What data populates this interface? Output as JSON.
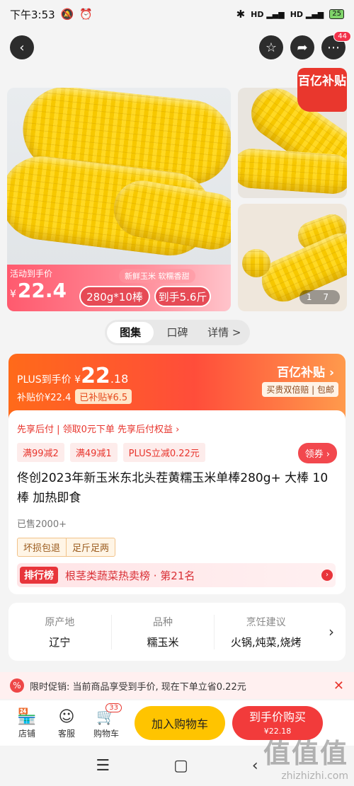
{
  "status": {
    "time": "下午3:53",
    "battery": "25"
  },
  "nav": {
    "back_icon": "back-icon",
    "fav_icon": "star-icon",
    "share_icon": "share-icon",
    "more_icon": "more-icon",
    "more_badge": "44"
  },
  "gallery": {
    "promo_label": "活动到手价",
    "promo_currency": "¥",
    "promo_price": "22.4",
    "tagline": "新鲜玉米 软糯香甜",
    "spec_pill": "280g*10棒",
    "weight_pill": "到手5.6斤",
    "subsidy_corner": "百亿补贴",
    "counter": "1 7"
  },
  "tabs": [
    "图集",
    "口碑",
    "详情 >"
  ],
  "price": {
    "plus_label": "PLUS到手价",
    "currency": "¥",
    "plus_int": "22",
    "plus_dec": ".18",
    "subsidy_label": "补贴价¥22.4",
    "subsidy_chip": "已补贴¥6.5",
    "brand": "百亿补贴 ›",
    "brand_sub": "买贵双倍赔 | 包邮"
  },
  "info": {
    "paylater": "先享后付 | 领取0元下单 先享后付权益 ›",
    "coupons": [
      "满99减2",
      "满49减1",
      "PLUS立减0.22元"
    ],
    "coupon_btn": "领券 ›",
    "title": "佟创2023年新玉米东北头茬黄糯玉米单棒280g+ 大棒 10棒 加热即食",
    "sold": "已售2000+",
    "guarantees": [
      "坏损包退",
      "足斤足两"
    ],
    "rank_tag": "排行榜",
    "rank_text": "根茎类蔬菜热卖榜 · 第21名"
  },
  "attrs": [
    {
      "k": "原产地",
      "v": "辽宁"
    },
    {
      "k": "品种",
      "v": "糯玉米"
    },
    {
      "k": "烹饪建议",
      "v": "火锅,炖菜,烧烤"
    }
  ],
  "notice": {
    "text": "限时促销: 当前商品享受到手价, 现在下单立省0.22元"
  },
  "bottom": {
    "store": "店铺",
    "service": "客服",
    "cart": "购物车",
    "cart_badge": "33",
    "add_cart": "加入购物车",
    "buy": "到手价购买",
    "buy_sub": "¥22.18"
  },
  "watermark": {
    "big": "值值值",
    "small": "zhizhizhi.com"
  },
  "colors": {
    "accent_red": "#f23b3b",
    "accent_orange": "#ff6a1a",
    "cart_yellow": "#ffc400"
  }
}
